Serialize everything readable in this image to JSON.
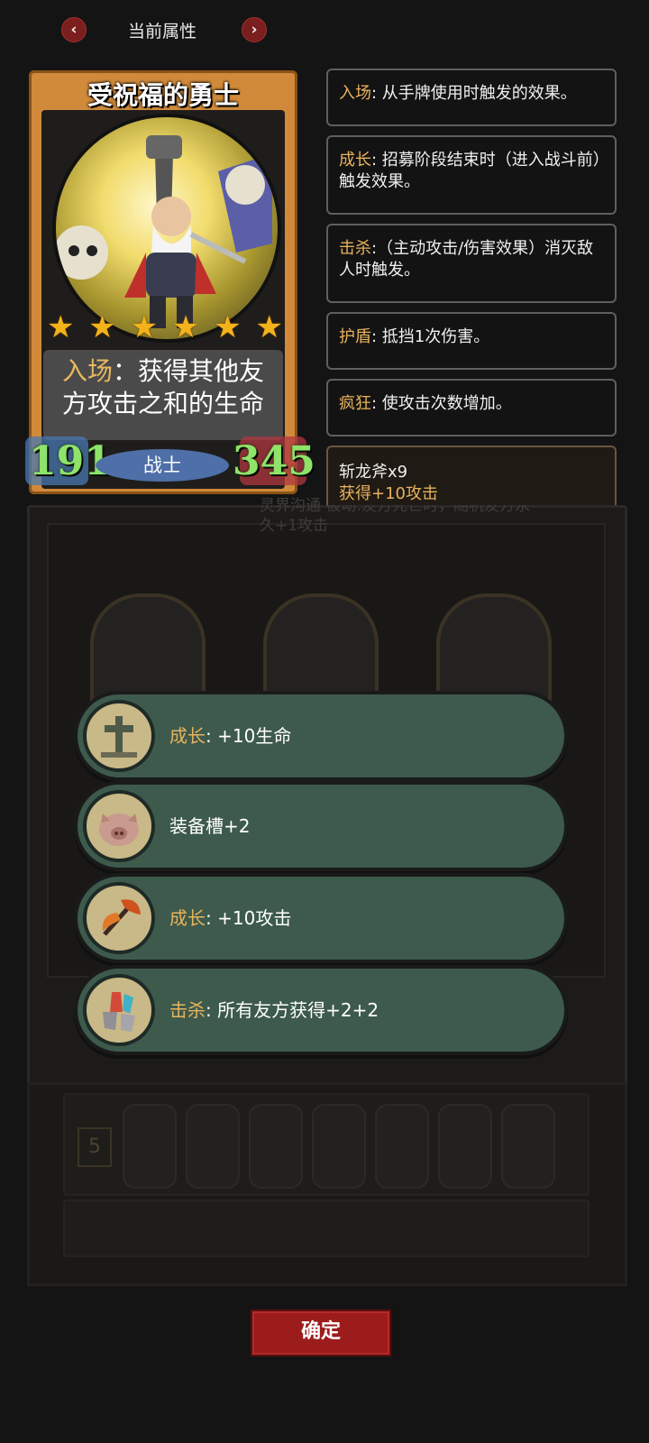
{
  "header": {
    "title": "当前属性",
    "prev_icon": "‹",
    "next_icon": "›"
  },
  "card": {
    "name": "受祝福的勇士",
    "stars": 6,
    "effect_keyword": "入场",
    "effect_line1_rest": "：获得其他友",
    "effect_line2": "方攻击之和的生命",
    "attack": "191",
    "health": "345",
    "class": "战士",
    "colors": {
      "frame": "#d08a3a",
      "stat": "#8fe36a",
      "star": "#f3b21c"
    }
  },
  "keywords": [
    {
      "key": "入场",
      "text": ": 从手牌使用时触发的效果。"
    },
    {
      "key": "成长",
      "text": ": 招募阶段结束时（进入战斗前）触发效果。"
    },
    {
      "key": "击杀",
      "text": ":（主动攻击/伤害效果）消灭敌人时触发。"
    },
    {
      "key": "护盾",
      "text": ": 抵挡1次伤害。"
    },
    {
      "key": "疯狂",
      "text": ": 使攻击次数增加。"
    }
  ],
  "equipment": {
    "name": "斩龙斧x9",
    "effect": "获得+10攻击"
  },
  "background": {
    "line1": "灵界沟通 被动:友方死亡时，随机友方永",
    "line2": "久+1攻击",
    "badge": "5"
  },
  "options": [
    {
      "icon": "grave-cross-icon",
      "keyword": "成长",
      "sep": ":",
      "text": "+10生命"
    },
    {
      "icon": "pig-icon",
      "keyword": "",
      "sep": "",
      "text": "装备槽+2"
    },
    {
      "icon": "axe-icon",
      "keyword": "成长",
      "sep": ":",
      "text": "+10攻击"
    },
    {
      "icon": "crystal-shield-icon",
      "keyword": "击杀",
      "sep": ":",
      "text": "所有友方获得+2+2"
    }
  ],
  "confirm_label": "确定"
}
